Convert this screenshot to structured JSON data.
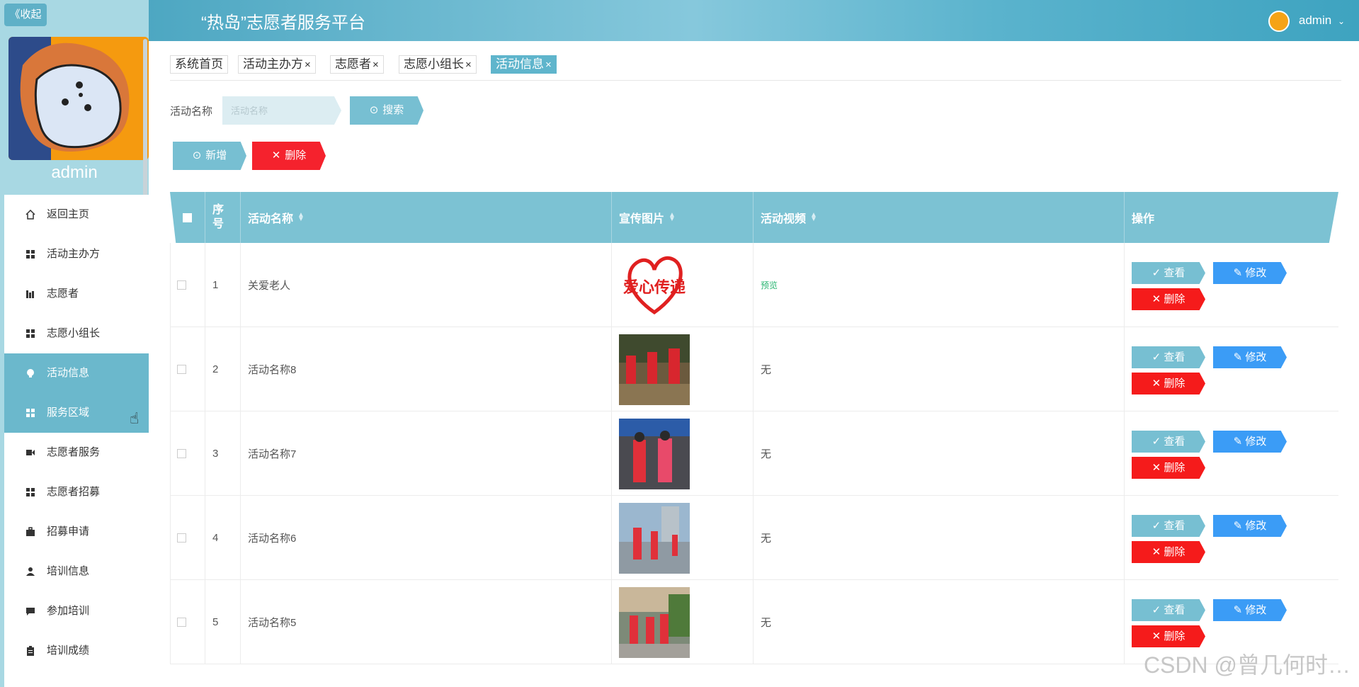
{
  "sidebar": {
    "collapse_label": "《收起",
    "username": "admin",
    "items": [
      {
        "label": "返回主页",
        "icon": "home-icon"
      },
      {
        "label": "活动主办方",
        "icon": "grid-icon"
      },
      {
        "label": "志愿者",
        "icon": "chart-icon"
      },
      {
        "label": "志愿小组长",
        "icon": "grid-icon"
      },
      {
        "label": "活动信息",
        "icon": "bulb-icon",
        "active": true
      },
      {
        "label": "服务区域",
        "icon": "grid-icon",
        "active": true
      },
      {
        "label": "志愿者服务",
        "icon": "video-icon"
      },
      {
        "label": "志愿者招募",
        "icon": "grid-icon"
      },
      {
        "label": "招募申请",
        "icon": "briefcase-icon"
      },
      {
        "label": "培训信息",
        "icon": "user-icon"
      },
      {
        "label": "参加培训",
        "icon": "chat-icon"
      },
      {
        "label": "培训成绩",
        "icon": "clipboard-icon"
      }
    ]
  },
  "header": {
    "title": "“热岛”志愿者服务平台",
    "username": "admin",
    "caret": "⌄"
  },
  "tabs": [
    {
      "label": "系统首页",
      "closable": false
    },
    {
      "label": "活动主办方",
      "closable": true
    },
    {
      "label": "志愿者",
      "closable": true
    },
    {
      "label": "志愿小组长",
      "closable": true
    },
    {
      "label": "活动信息",
      "closable": true,
      "active": true
    }
  ],
  "tab_close": "×",
  "search": {
    "label": "活动名称",
    "placeholder": "活动名称",
    "button": "搜索"
  },
  "toolbar": {
    "add_label": "新增",
    "delete_label": "删除"
  },
  "table": {
    "columns": [
      "序号",
      "活动名称",
      "宣传图片",
      "活动视频",
      "操作"
    ],
    "rows": [
      {
        "index": "1",
        "name": "关爱老人",
        "picture": "love-relay-logo",
        "video": "预览",
        "video_is_link": true
      },
      {
        "index": "2",
        "name": "活动名称8",
        "picture": "volunteers-tree-photo",
        "video": "无"
      },
      {
        "index": "3",
        "name": "活动名称7",
        "picture": "volunteers-street-photo",
        "video": "无"
      },
      {
        "index": "4",
        "name": "活动名称6",
        "picture": "volunteers-cleaning-photo",
        "video": "无"
      },
      {
        "index": "5",
        "name": "活动名称5",
        "picture": "volunteers-sidewalk-photo",
        "video": "无"
      }
    ],
    "actions": {
      "view": "查看",
      "edit": "修改",
      "delete": "删除"
    }
  },
  "logo_text": "爱心传递",
  "watermark": "CSDN @曾几何时…",
  "colors": {
    "accent": "#77bfd2",
    "header": "#4da7c2",
    "danger": "#f5222d",
    "edit": "#3b9cf6",
    "active_menu": "#6bb8cc"
  }
}
